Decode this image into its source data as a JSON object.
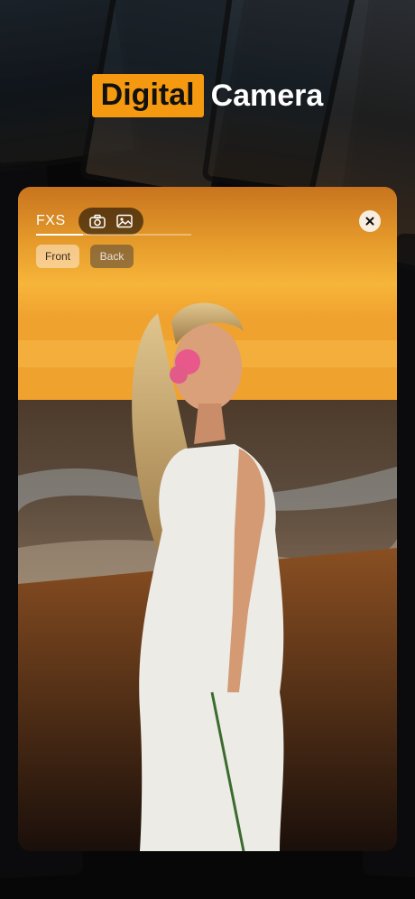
{
  "headline": {
    "highlight": "Digital",
    "rest": "Camera"
  },
  "card": {
    "title": "FXS",
    "modes": [
      {
        "icon": "camera-icon"
      },
      {
        "icon": "image-icon"
      }
    ],
    "close_icon": "close-icon",
    "camera_toggle": {
      "front": "Front",
      "back": "Back",
      "selected": "Front"
    }
  },
  "colors": {
    "accent": "#f59a10",
    "headline_text": "#ffffff",
    "card_bg": "#111111"
  }
}
